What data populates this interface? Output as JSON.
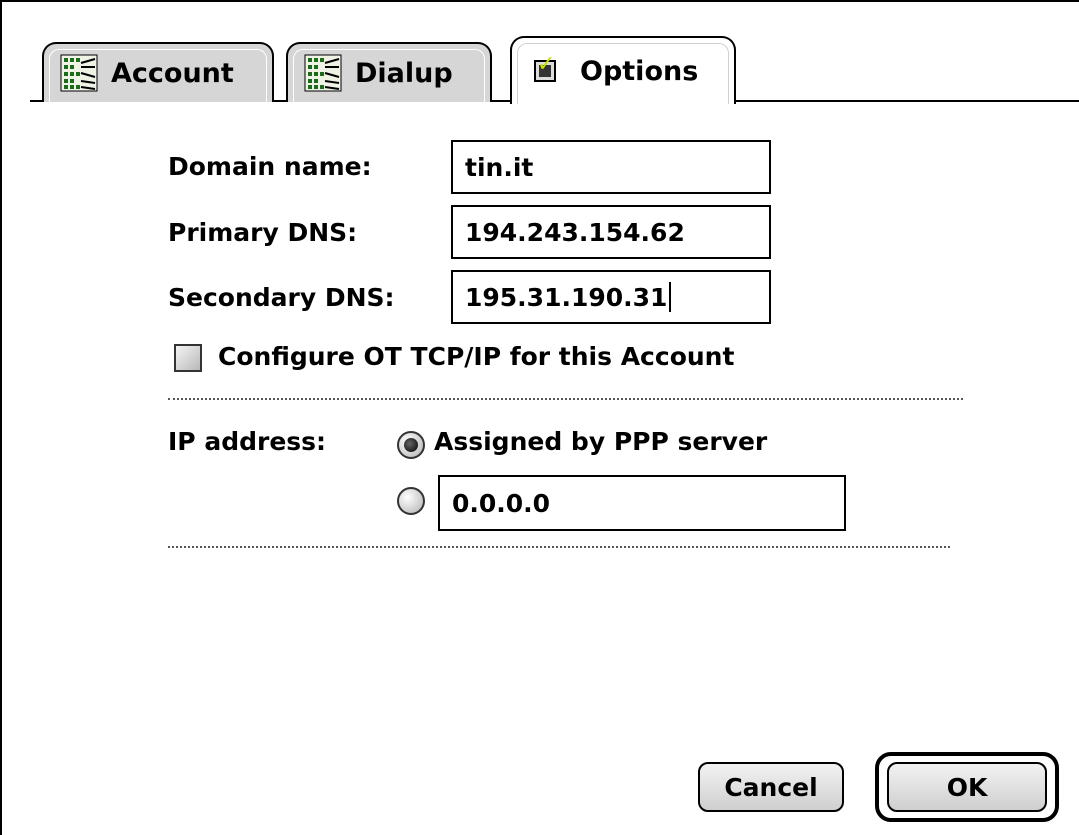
{
  "tabs": [
    {
      "label": "Account",
      "icon": "network-icon",
      "active": false
    },
    {
      "label": "Dialup",
      "icon": "network-icon",
      "active": false
    },
    {
      "label": "Options",
      "icon": "checkbox-checked-icon",
      "active": true
    }
  ],
  "form": {
    "domain_label": "Domain name:",
    "domain_value": "tin.it",
    "primary_dns_label": "Primary DNS:",
    "primary_dns_value": "194.243.154.62",
    "secondary_dns_label": "Secondary DNS:",
    "secondary_dns_value": "195.31.190.31",
    "configure_label": "Configure OT TCP/IP for this Account",
    "configure_checked": false,
    "ip_label": "IP address:",
    "ip_option_assigned": "Assigned by PPP server",
    "ip_assigned_selected": true,
    "ip_manual_value": "0.0.0.0"
  },
  "buttons": {
    "cancel": "Cancel",
    "ok": "OK"
  },
  "colors": {
    "tab_background": "#d6d6d6",
    "window_background": "#ffffff",
    "check_accent": "#c8e000"
  }
}
